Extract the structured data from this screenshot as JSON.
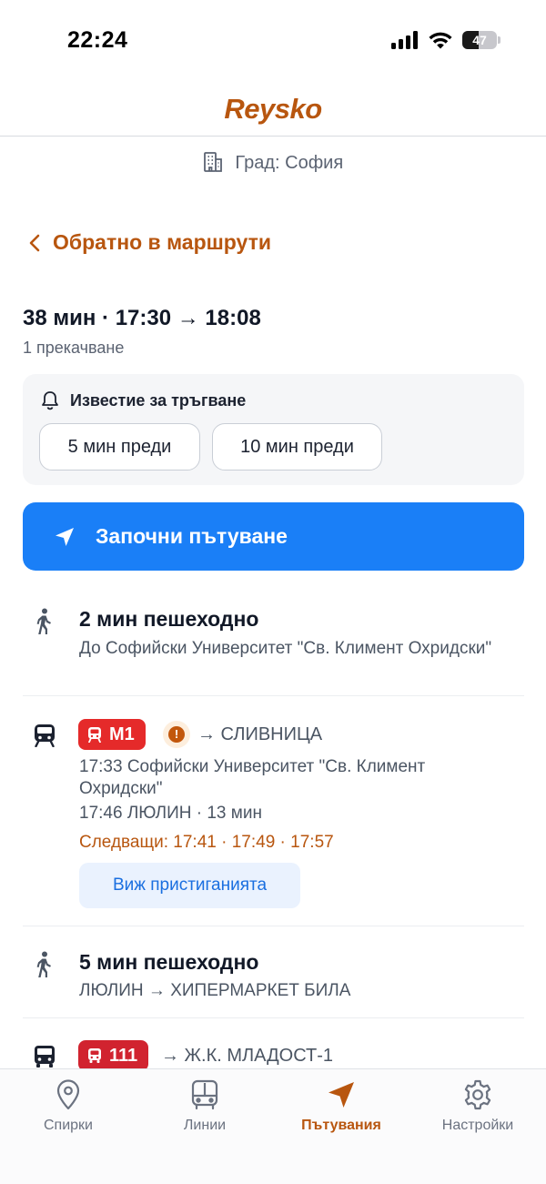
{
  "status_bar": {
    "time": "22:24",
    "battery": "47",
    "battery_level": 0.47
  },
  "app": {
    "logo": "Reysko"
  },
  "city": {
    "label": "Град: София"
  },
  "back": {
    "label": "Обратно в маршрути"
  },
  "trip": {
    "summary": "38 мин · 17:30 → 18:08",
    "transfers": "1 прекачване"
  },
  "notify": {
    "title": "Известие за тръгване",
    "options": [
      "5 мин преди",
      "10 мин преди"
    ]
  },
  "start_button": {
    "label": "Започни пътуване"
  },
  "legs": [
    {
      "type": "walk",
      "title": "2 мин пешеходно",
      "sub": "До Софийски Университет \"Св. Климент Охридски\""
    },
    {
      "type": "metro",
      "line": "M1",
      "destination": "→ СЛИВНИЦА",
      "from": "17:33 Софийски Университет \"Св. Климент Охридски\"",
      "to": "17:46 ЛЮЛИН · 13 мин",
      "next": "Следващи: 17:41 · 17:49 · 17:57",
      "arrivals_label": "Виж пристиганията"
    },
    {
      "type": "walk",
      "title": "5 мин пешеходно",
      "sub": "ЛЮЛИН → ХИПЕРМАРКЕТ БИЛА"
    },
    {
      "type": "bus",
      "line": "111",
      "destination": "→ Ж.К. МЛАДОСТ-1"
    }
  ],
  "tabs": [
    {
      "label": "Спирки",
      "icon": "map-pin-icon"
    },
    {
      "label": "Линии",
      "icon": "bus-icon"
    },
    {
      "label": "Пътувания",
      "icon": "navigation-icon",
      "active": true
    },
    {
      "label": "Настройки",
      "icon": "gear-icon"
    }
  ],
  "colors": {
    "brand": "#b8560f",
    "primary": "#1a7ff7",
    "metro": "#e52a2a",
    "bus": "#d1232f"
  }
}
